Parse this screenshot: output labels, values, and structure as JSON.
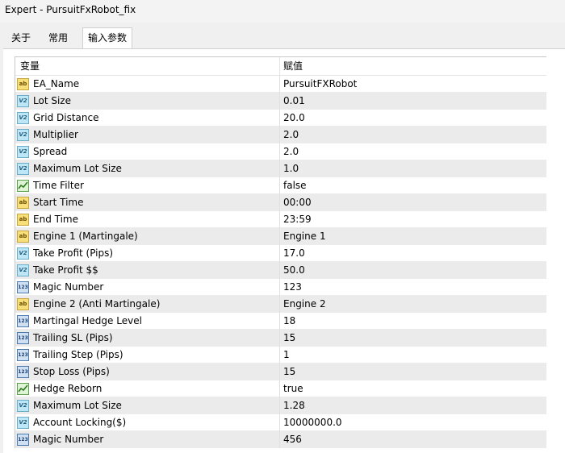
{
  "window": {
    "title": "Expert - PursuitFxRobot_fix"
  },
  "tabs": [
    {
      "label": "关于",
      "active": false
    },
    {
      "label": "常用",
      "active": false
    },
    {
      "label": "输入参数",
      "active": true
    }
  ],
  "table": {
    "columns": {
      "variable": "变量",
      "value": "赋值"
    },
    "rows": [
      {
        "icon": "string-icon",
        "badge": "ab",
        "name": "EA_Name",
        "value": "PursuitFXRobot"
      },
      {
        "icon": "double-icon",
        "badge": "V2",
        "name": "Lot Size",
        "value": "0.01"
      },
      {
        "icon": "double-icon",
        "badge": "V2",
        "name": "Grid Distance",
        "value": "20.0"
      },
      {
        "icon": "double-icon",
        "badge": "V2",
        "name": "Multiplier",
        "value": "2.0"
      },
      {
        "icon": "double-icon",
        "badge": "V2",
        "name": "Spread",
        "value": "2.0"
      },
      {
        "icon": "double-icon",
        "badge": "V2",
        "name": "Maximum Lot Size",
        "value": "1.0"
      },
      {
        "icon": "bool-icon",
        "badge": "",
        "name": "Time Filter",
        "value": "false"
      },
      {
        "icon": "string-icon",
        "badge": "ab",
        "name": "Start Time",
        "value": "00:00"
      },
      {
        "icon": "string-icon",
        "badge": "ab",
        "name": "End Time",
        "value": "23:59"
      },
      {
        "icon": "string-icon",
        "badge": "ab",
        "name": "Engine 1 (Martingale)",
        "value": "Engine 1"
      },
      {
        "icon": "double-icon",
        "badge": "V2",
        "name": "Take Profit (Pips)",
        "value": "17.0"
      },
      {
        "icon": "double-icon",
        "badge": "V2",
        "name": "Take Profit $$",
        "value": "50.0"
      },
      {
        "icon": "integer-icon",
        "badge": "123",
        "name": "Magic Number",
        "value": "123"
      },
      {
        "icon": "string-icon",
        "badge": "ab",
        "name": "Engine 2 (Anti Martingale)",
        "value": "Engine 2"
      },
      {
        "icon": "integer-icon",
        "badge": "123",
        "name": "Martingal Hedge Level",
        "value": "18"
      },
      {
        "icon": "integer-icon",
        "badge": "123",
        "name": "Trailing SL (Pips)",
        "value": "15"
      },
      {
        "icon": "integer-icon",
        "badge": "123",
        "name": "Trailing Step (Pips)",
        "value": "1"
      },
      {
        "icon": "integer-icon",
        "badge": "123",
        "name": "Stop Loss (Pips)",
        "value": "15"
      },
      {
        "icon": "bool-icon",
        "badge": "",
        "name": "Hedge Reborn",
        "value": "true"
      },
      {
        "icon": "double-icon",
        "badge": "V2",
        "name": "Maximum Lot Size",
        "value": "1.28"
      },
      {
        "icon": "double-icon",
        "badge": "V2",
        "name": "Account Locking($)",
        "value": "10000000.0"
      },
      {
        "icon": "integer-icon",
        "badge": "123",
        "name": "Magic Number",
        "value": "456"
      }
    ]
  }
}
